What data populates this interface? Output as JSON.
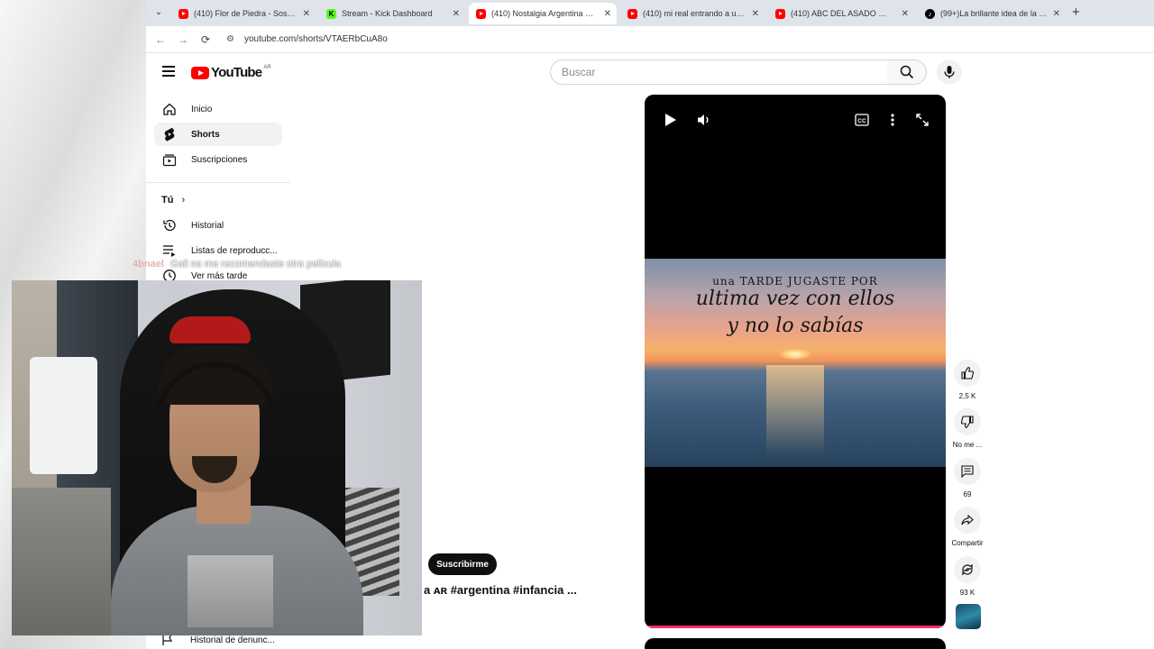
{
  "browser": {
    "tabs": [
      {
        "title": "(410) Flor de Piedra - Sos Botón",
        "favicon": "youtube-icon",
        "active": false
      },
      {
        "title": "Stream - Kick Dashboard",
        "favicon": "kick-icon",
        "active": false
      },
      {
        "title": "(410) Nostalgia Argentina 🇦🇷 #a",
        "favicon": "youtube-icon",
        "active": true
      },
      {
        "title": "(410) mi real entrando a una tie",
        "favicon": "youtube-icon",
        "active": false
      },
      {
        "title": "(410) ABC DEL ASADO 🇦🇷🥩 #a",
        "favicon": "youtube-icon",
        "active": false
      },
      {
        "title": "(99+)La brillante idea de la Inte",
        "favicon": "tiktok-icon",
        "active": false
      }
    ],
    "url": "youtube.com/shorts/VTAERbCuA8o"
  },
  "youtube": {
    "logo_text": "YouTube",
    "region": "AR",
    "search_placeholder": "Buscar",
    "sidebar": {
      "items": [
        {
          "label": "Inicio",
          "icon": "home-icon"
        },
        {
          "label": "Shorts",
          "icon": "shorts-icon"
        },
        {
          "label": "Suscripciones",
          "icon": "subscriptions-icon"
        }
      ],
      "you_label": "Tú",
      "you_items": [
        {
          "label": "Historial",
          "icon": "history-icon"
        },
        {
          "label": "Listas de reproducc...",
          "icon": "playlist-icon"
        },
        {
          "label": "Ver más tarde",
          "icon": "watch-later-icon"
        }
      ],
      "report_history": "Historial de denunc..."
    },
    "short": {
      "overlay_line1": "una TARDE JUGASTE POR",
      "overlay_line2": "ultima vez con ellos",
      "overlay_line3": "y no lo sabías",
      "subscribe_label": "Suscribirme",
      "title_fragment": "a ᴀʀ #argentina #infancia ..."
    },
    "actions": {
      "likes": "2,5 K",
      "dislike_label": "No me ...",
      "comments": "69",
      "share_label": "Compartir",
      "remix_count": "93 K"
    }
  },
  "stream": {
    "chat_user": "4bnael",
    "chat_message": "Gail no me recomendaste otra película"
  },
  "colors": {
    "yt_red": "#ff0000",
    "progress": "#ff2f6d",
    "kick_green": "#53fc18"
  }
}
